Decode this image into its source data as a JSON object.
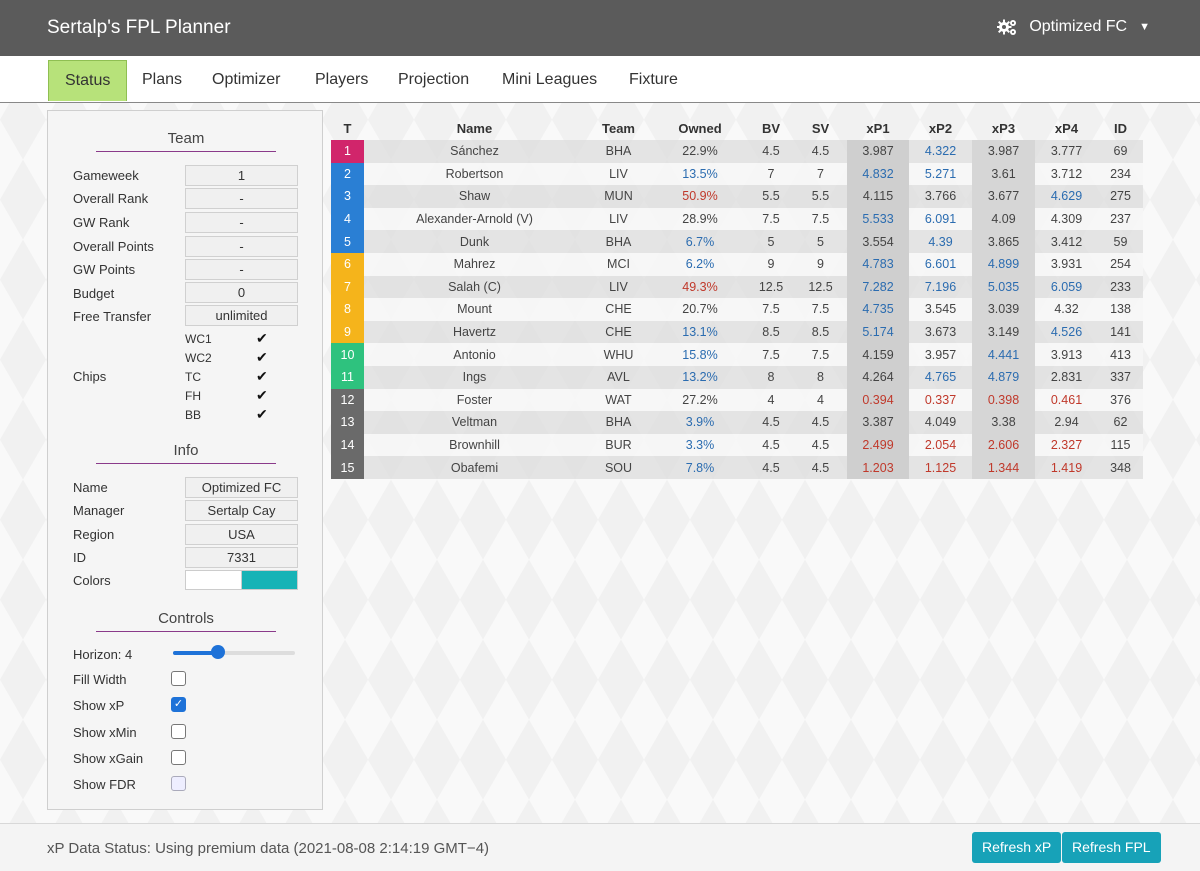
{
  "header": {
    "title": "Sertalp's FPL Planner",
    "team_menu": "Optimized FC"
  },
  "tabs": [
    "Status",
    "Plans",
    "Optimizer",
    "Players",
    "Projection",
    "Mini Leagues",
    "Fixture"
  ],
  "team": {
    "title": "Team",
    "rows": [
      {
        "label": "Gameweek",
        "value": "1"
      },
      {
        "label": "Overall Rank",
        "value": "-"
      },
      {
        "label": "GW Rank",
        "value": "-"
      },
      {
        "label": "Overall Points",
        "value": "-"
      },
      {
        "label": "GW Points",
        "value": "-"
      },
      {
        "label": "Budget",
        "value": "0"
      },
      {
        "label": "Free Transfer",
        "value": "unlimited"
      }
    ],
    "chips_label": "Chips",
    "chips": [
      "WC1",
      "WC2",
      "TC",
      "FH",
      "BB"
    ],
    "check": "✔"
  },
  "info": {
    "title": "Info",
    "rows": [
      {
        "label": "Name",
        "value": "Optimized FC"
      },
      {
        "label": "Manager",
        "value": "Sertalp Cay"
      },
      {
        "label": "Region",
        "value": "USA"
      },
      {
        "label": "ID",
        "value": "7331"
      }
    ],
    "colors_label": "Colors",
    "color1": "#ffffff",
    "color2": "#17b3b6"
  },
  "controls": {
    "title": "Controls",
    "horizon_label": "Horizon: 4",
    "horizon_value_fraction": 0.37,
    "options": [
      {
        "label": "Fill Width",
        "checked": false,
        "disabled": false
      },
      {
        "label": "Show xP",
        "checked": true,
        "disabled": false
      },
      {
        "label": "Show xMin",
        "checked": false,
        "disabled": false
      },
      {
        "label": "Show xGain",
        "checked": false,
        "disabled": false
      },
      {
        "label": "Show FDR",
        "checked": false,
        "disabled": true
      }
    ]
  },
  "table": {
    "columns": [
      "T",
      "Name",
      "Team",
      "Owned",
      "BV",
      "SV",
      "xP1",
      "xP2",
      "xP3",
      "xP4",
      "ID"
    ],
    "type_colors": {
      "gk": "#d1256b",
      "def": "#2a7fd4",
      "mid": "#f5b41b",
      "fwd": "#2ec27e",
      "bench": "#6a6a6a"
    },
    "rows": [
      {
        "t": "1",
        "type": "gk",
        "name": "Sánchez",
        "team": "BHA",
        "owned": "22.9%",
        "bv": "4.5",
        "sv": "4.5",
        "xp": [
          "3.987",
          "4.322",
          "3.987",
          "3.777"
        ],
        "id": "69",
        "oc": "",
        "xc": [
          "",
          "blue",
          "",
          ""
        ]
      },
      {
        "t": "2",
        "type": "def",
        "name": "Robertson",
        "team": "LIV",
        "owned": "13.5%",
        "bv": "7",
        "sv": "7",
        "xp": [
          "4.832",
          "5.271",
          "3.61",
          "3.712"
        ],
        "id": "234",
        "oc": "blue",
        "xc": [
          "blue",
          "blue",
          "",
          ""
        ]
      },
      {
        "t": "3",
        "type": "def",
        "name": "Shaw",
        "team": "MUN",
        "owned": "50.9%",
        "bv": "5.5",
        "sv": "5.5",
        "xp": [
          "4.115",
          "3.766",
          "3.677",
          "4.629"
        ],
        "id": "275",
        "oc": "red",
        "xc": [
          "",
          "",
          "",
          "blue"
        ]
      },
      {
        "t": "4",
        "type": "def",
        "name": "Alexander-Arnold (V)",
        "team": "LIV",
        "owned": "28.9%",
        "bv": "7.5",
        "sv": "7.5",
        "xp": [
          "5.533",
          "6.091",
          "4.09",
          "4.309"
        ],
        "id": "237",
        "oc": "",
        "xc": [
          "blue",
          "blue",
          "",
          ""
        ]
      },
      {
        "t": "5",
        "type": "def",
        "name": "Dunk",
        "team": "BHA",
        "owned": "6.7%",
        "bv": "5",
        "sv": "5",
        "xp": [
          "3.554",
          "4.39",
          "3.865",
          "3.412"
        ],
        "id": "59",
        "oc": "blue",
        "xc": [
          "",
          "blue",
          "",
          ""
        ]
      },
      {
        "t": "6",
        "type": "mid",
        "name": "Mahrez",
        "team": "MCI",
        "owned": "6.2%",
        "bv": "9",
        "sv": "9",
        "xp": [
          "4.783",
          "6.601",
          "4.899",
          "3.931"
        ],
        "id": "254",
        "oc": "blue",
        "xc": [
          "blue",
          "blue",
          "blue",
          ""
        ]
      },
      {
        "t": "7",
        "type": "mid",
        "name": "Salah (C)",
        "team": "LIV",
        "owned": "49.3%",
        "bv": "12.5",
        "sv": "12.5",
        "xp": [
          "7.282",
          "7.196",
          "5.035",
          "6.059"
        ],
        "id": "233",
        "oc": "red",
        "xc": [
          "blue",
          "blue",
          "blue",
          "blue"
        ]
      },
      {
        "t": "8",
        "type": "mid",
        "name": "Mount",
        "team": "CHE",
        "owned": "20.7%",
        "bv": "7.5",
        "sv": "7.5",
        "xp": [
          "4.735",
          "3.545",
          "3.039",
          "4.32"
        ],
        "id": "138",
        "oc": "",
        "xc": [
          "blue",
          "",
          "",
          ""
        ]
      },
      {
        "t": "9",
        "type": "mid",
        "name": "Havertz",
        "team": "CHE",
        "owned": "13.1%",
        "bv": "8.5",
        "sv": "8.5",
        "xp": [
          "5.174",
          "3.673",
          "3.149",
          "4.526"
        ],
        "id": "141",
        "oc": "blue",
        "xc": [
          "blue",
          "",
          "",
          "blue"
        ]
      },
      {
        "t": "10",
        "type": "fwd",
        "name": "Antonio",
        "team": "WHU",
        "owned": "15.8%",
        "bv": "7.5",
        "sv": "7.5",
        "xp": [
          "4.159",
          "3.957",
          "4.441",
          "3.913"
        ],
        "id": "413",
        "oc": "blue",
        "xc": [
          "",
          "",
          "blue",
          ""
        ]
      },
      {
        "t": "11",
        "type": "fwd",
        "name": "Ings",
        "team": "AVL",
        "owned": "13.2%",
        "bv": "8",
        "sv": "8",
        "xp": [
          "4.264",
          "4.765",
          "4.879",
          "2.831"
        ],
        "id": "337",
        "oc": "blue",
        "xc": [
          "",
          "blue",
          "blue",
          ""
        ]
      },
      {
        "t": "12",
        "type": "bench",
        "name": "Foster",
        "team": "WAT",
        "owned": "27.2%",
        "bv": "4",
        "sv": "4",
        "xp": [
          "0.394",
          "0.337",
          "0.398",
          "0.461"
        ],
        "id": "376",
        "oc": "",
        "xc": [
          "red",
          "red",
          "red",
          "red"
        ]
      },
      {
        "t": "13",
        "type": "bench",
        "name": "Veltman",
        "team": "BHA",
        "owned": "3.9%",
        "bv": "4.5",
        "sv": "4.5",
        "xp": [
          "3.387",
          "4.049",
          "3.38",
          "2.94"
        ],
        "id": "62",
        "oc": "blue",
        "xc": [
          "",
          "",
          "",
          ""
        ]
      },
      {
        "t": "14",
        "type": "bench",
        "name": "Brownhill",
        "team": "BUR",
        "owned": "3.3%",
        "bv": "4.5",
        "sv": "4.5",
        "xp": [
          "2.499",
          "2.054",
          "2.606",
          "2.327"
        ],
        "id": "115",
        "oc": "blue",
        "xc": [
          "red",
          "red",
          "red",
          "red"
        ]
      },
      {
        "t": "15",
        "type": "bench",
        "name": "Obafemi",
        "team": "SOU",
        "owned": "7.8%",
        "bv": "4.5",
        "sv": "4.5",
        "xp": [
          "1.203",
          "1.125",
          "1.344",
          "1.419"
        ],
        "id": "348",
        "oc": "blue",
        "xc": [
          "red",
          "red",
          "red",
          "red"
        ]
      }
    ]
  },
  "footer": {
    "status": "xP Data Status: Using premium data (2021-08-08 2:14:19 GMT−4)",
    "refresh_xp": "Refresh xP",
    "refresh_fpl": "Refresh FPL"
  }
}
